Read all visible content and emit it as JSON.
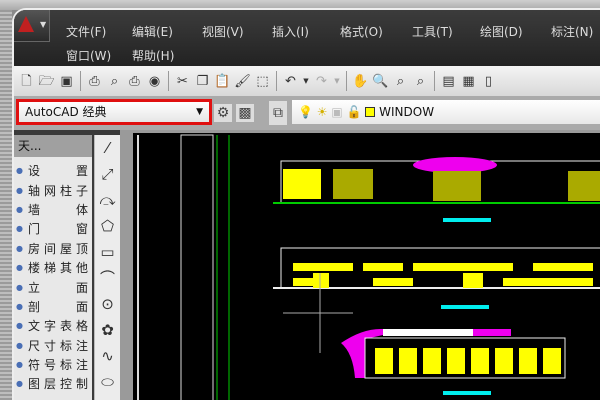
{
  "menu": {
    "row1": [
      "文件(F)",
      "编辑(E)",
      "视图(V)",
      "插入(I)",
      "格式(O)",
      "工具(T)",
      "绘图(D)",
      "标注(N)"
    ],
    "row2": [
      "窗口(W)",
      "帮助(H)"
    ]
  },
  "toolbar": {
    "icons": [
      "new-icon",
      "open-icon",
      "save-icon",
      "print-icon",
      "preview-icon",
      "publish-icon",
      "3d-dwf-icon",
      "cut-icon",
      "copy-icon",
      "paste-icon",
      "match-properties-icon",
      "block-editor-icon",
      "undo-icon",
      "redo-icon",
      "pan-icon",
      "zoom-realtime-icon",
      "zoom-window-icon",
      "zoom-previous-icon",
      "properties-icon",
      "design-center-icon"
    ]
  },
  "workspace": {
    "selected": "AutoCAD 经典"
  },
  "layer": {
    "name": "WINDOW",
    "color": "#ffff00"
  },
  "panel": {
    "title": "天...",
    "items": [
      "设　　置",
      "轴网柱子",
      "墙　　体",
      "门　　窗",
      "房间屋顶",
      "楼梯其他",
      "立　　面",
      "剖　　面",
      "文字表格",
      "尺寸标注",
      "符号标注",
      "图层控制"
    ]
  },
  "draw_tools": [
    "line-icon",
    "polyline-icon",
    "construction-line-icon",
    "polygon-icon",
    "rectangle-icon",
    "arc-icon",
    "circle-icon",
    "revision-cloud-icon",
    "spline-icon",
    "ellipse-icon"
  ],
  "colors": {
    "highlight": "#e01010",
    "canvas": "#000000"
  }
}
